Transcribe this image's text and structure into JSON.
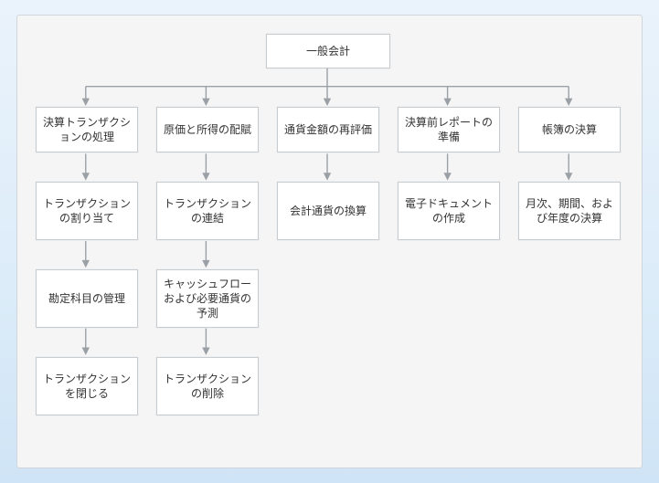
{
  "chart_data": {
    "type": "tree",
    "root": "一般会計",
    "columns": [
      {
        "head": "決算トランザクションの処理",
        "children": [
          "トランザクションの割り当て",
          "勘定科目の管理",
          "トランザクションを閉じる"
        ]
      },
      {
        "head": "原価と所得の配賦",
        "children": [
          "トランザクションの連結",
          "キャッシュフローおよび必要通貨の予測",
          "トランザクションの削除"
        ]
      },
      {
        "head": "通貨金額の再評価",
        "children": [
          "会計通貨の換算"
        ]
      },
      {
        "head": "決算前レポートの準備",
        "children": [
          "電子ドキュメントの作成"
        ]
      },
      {
        "head": "帳簿の決算",
        "children": [
          "月次、期間、および年度の決算"
        ]
      }
    ]
  }
}
